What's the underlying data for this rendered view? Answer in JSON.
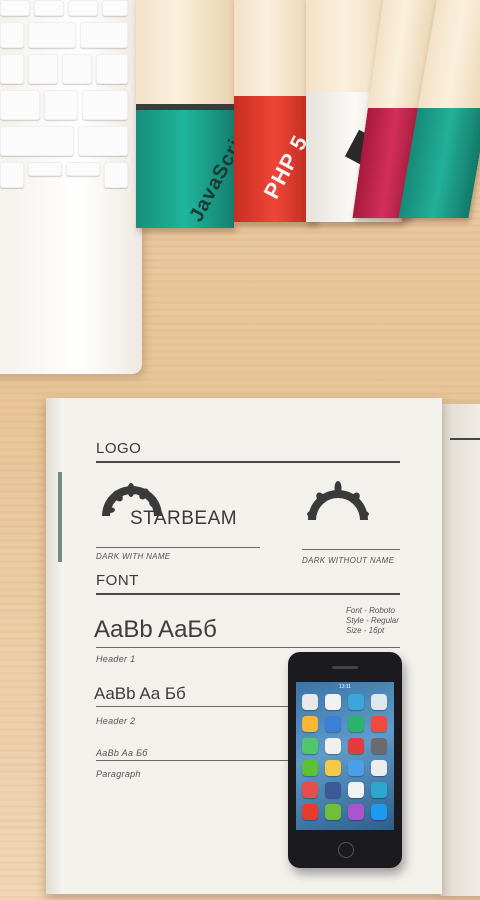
{
  "books": [
    {
      "title": "JavaScript",
      "cover": "#1aa58f"
    },
    {
      "title": "PHP 5",
      "cover": "#e03a2b"
    },
    {
      "title": "",
      "cover": "#f5f3ef"
    },
    {
      "title": "",
      "cover": "#c8244f"
    },
    {
      "title": "",
      "cover": "#1e9e8a"
    }
  ],
  "notebook": {
    "logo": {
      "heading": "LOGO",
      "brand_name": "STARBEAM",
      "caption_with_name": "DARK WITH NAME",
      "caption_without_name": "DARK WITHOUT NAME"
    },
    "font": {
      "heading": "FONT",
      "header1_sample": "AaBb AaБб",
      "header1_label": "Header 1",
      "header2_sample": "AaBb Aa Бб",
      "header2_label": "Header 2",
      "paragraph_sample": "AaBb Aa Бб",
      "paragraph_label": "Paragraph",
      "meta_font": "Font - Roboto",
      "meta_style": "Style - Regular",
      "meta_size": "Size - 16pt"
    }
  },
  "phone": {
    "status_time": "13:11",
    "app_colors": [
      "#e8e8e8",
      "#f2f2f2",
      "#3aa7d8",
      "#dfe7ee",
      "#f5b73a",
      "#3b7fd9",
      "#2bb36b",
      "#ef4a3c",
      "#52c66d",
      "#f0f0f0",
      "#e33b3b",
      "#6b6b6b",
      "#5bc236",
      "#f5c945",
      "#4b9fe8",
      "#ececec",
      "#e84d4d",
      "#3b5998",
      "#f1f1f1",
      "#2ca7d0",
      "#e83b2e",
      "#6fbf3c",
      "#aa55cc",
      "#1d9bf0"
    ]
  }
}
